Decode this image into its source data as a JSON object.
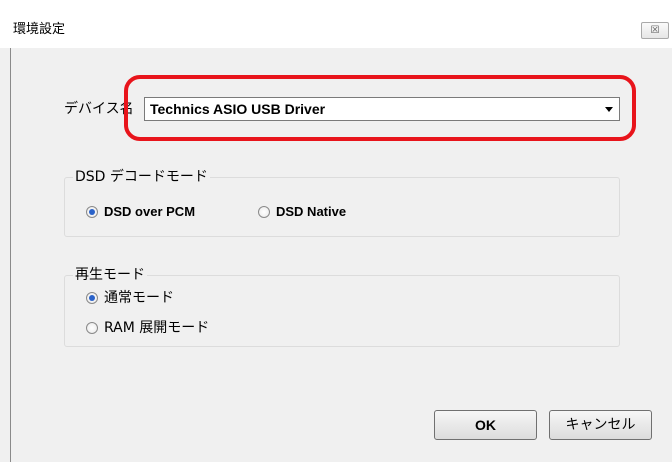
{
  "window": {
    "title": "環境設定",
    "close_glyph": "☒"
  },
  "device": {
    "label": "デバイス名",
    "selected": "Technics ASIO USB Driver"
  },
  "dsd_mode": {
    "legend": "DSD デコードモード",
    "options": [
      {
        "label": "DSD over PCM",
        "selected": true
      },
      {
        "label": "DSD Native",
        "selected": false
      }
    ]
  },
  "playback_mode": {
    "legend": "再生モード",
    "options": [
      {
        "label": "通常モード",
        "selected": true
      },
      {
        "label": "RAM 展開モード",
        "selected": false
      }
    ]
  },
  "buttons": {
    "ok": "OK",
    "cancel": "キャンセル"
  },
  "colors": {
    "highlight": "#e8141b",
    "radio_selected": "#2a62c9"
  }
}
